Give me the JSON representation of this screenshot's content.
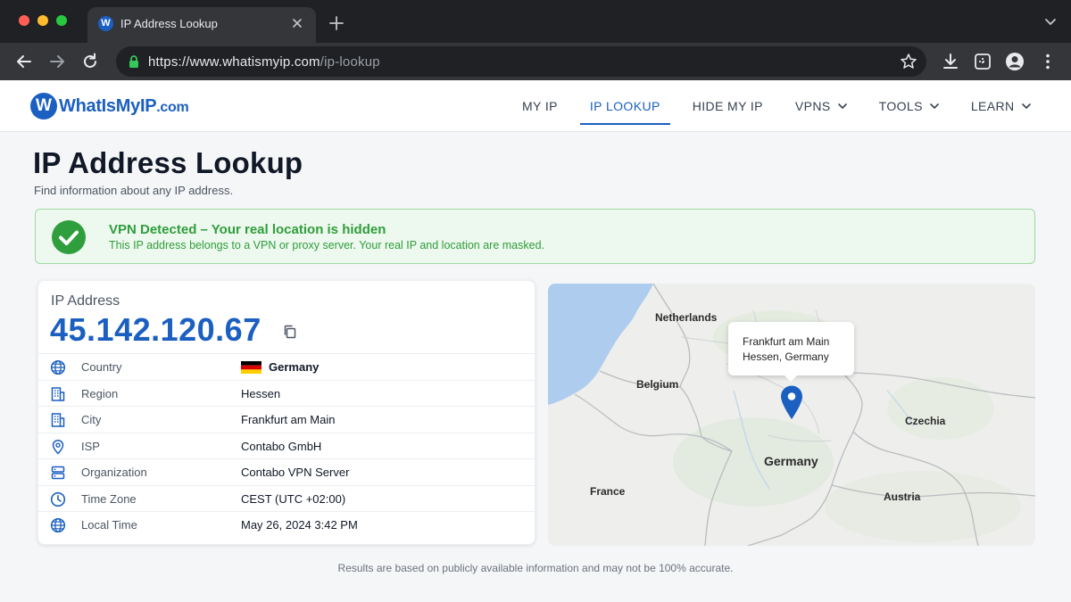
{
  "browser": {
    "tab_title": "IP Address Lookup",
    "tab_favicon": "W",
    "url_host": "https://www.whatismyip.com",
    "url_path": "/ip-lookup"
  },
  "site": {
    "logo_letter": "W",
    "logo_name": "WhatIsMyIP",
    "logo_ext": ".com",
    "nav": [
      {
        "label": "MY IP"
      },
      {
        "label": "IP LOOKUP"
      },
      {
        "label": "HIDE MY IP"
      },
      {
        "label": "VPNS"
      },
      {
        "label": "TOOLS"
      },
      {
        "label": "LEARN"
      }
    ],
    "active_nav": "IP LOOKUP",
    "accent_color": "#1b5fc1"
  },
  "page": {
    "title": "IP Address Lookup",
    "subtitle": "Find information about any IP address.",
    "alert": {
      "title": "VPN Detected – Your real location is hidden",
      "text": "This IP address belongs to a VPN or proxy server. Your real IP and location are masked.",
      "color": "#2f9e3c"
    },
    "ip_label": "IP Address",
    "ip_value": "45.142.120.67",
    "details": [
      {
        "icon": "globe-icon",
        "label": "Country",
        "value": "Germany"
      },
      {
        "icon": "building-icon",
        "label": "Region",
        "value": "Hessen"
      },
      {
        "icon": "building-icon",
        "label": "City",
        "value": "Frankfurt am Main"
      },
      {
        "icon": "location-pin-icon",
        "label": "ISP",
        "value": "Contabo GmbH"
      },
      {
        "icon": "server-icon",
        "label": "Organization",
        "value": "Contabo VPN Server"
      },
      {
        "icon": "clock-icon",
        "label": "Time Zone",
        "value": "CEST (UTC +02:00)"
      },
      {
        "icon": "globe-icon",
        "label": "Local Time",
        "value": "May 26, 2024 3:42 PM"
      }
    ],
    "map": {
      "labels": {
        "netherlands": "Netherlands",
        "belgium": "Belgium",
        "germany": "Germany",
        "france": "France",
        "czechia": "Czechia",
        "austria": "Austria"
      },
      "popup_line1": "Frankfurt am Main",
      "popup_line2": "Hessen, Germany"
    },
    "disclaimer": "Results are based on publicly available information and may not be 100% accurate."
  }
}
